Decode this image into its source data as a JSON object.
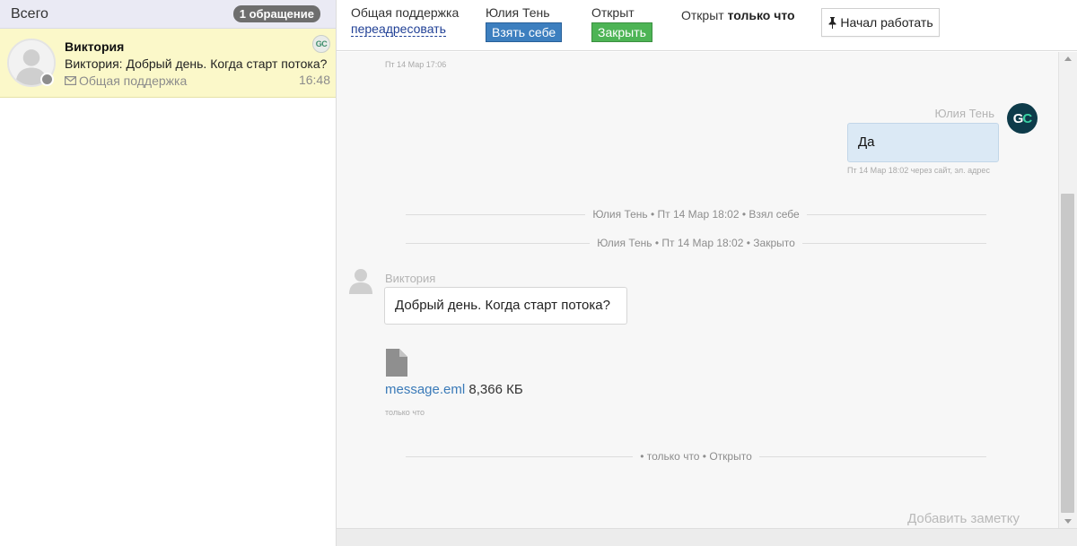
{
  "sidebar": {
    "title": "Всего",
    "count_badge": "1 обращение",
    "conversation": {
      "name": "Виктория",
      "preview": "Виктория: Добрый день. Когда старт потока?",
      "channel": "Общая поддержка",
      "time": "16:48",
      "agent_initials": "GC",
      "status_color": "#8e8e8e"
    }
  },
  "toolbar": {
    "department_label": "Общая поддержка",
    "redirect_link": "переадресовать",
    "agent_label": "Юлия Тень",
    "take_button": "Взять себе",
    "status_label": "Открыт",
    "close_button": "Закрыть",
    "opened_prefix": "Открыт",
    "opened_when": "только что",
    "start_button": "Начал работать"
  },
  "chat": {
    "top_timestamp": "Пт 14 Мар 17:06",
    "agent_message": {
      "sender": "Юлия Тень",
      "initials": "GC",
      "text": "Да",
      "meta": "Пт 14 Мар 18:02 через сайт, эл. адрес"
    },
    "system_events": [
      "Юлия Тень • Пт 14 Мар 18:02 • Взял себе",
      "Юлия Тень • Пт 14 Мар 18:02 • Закрыто"
    ],
    "customer_message": {
      "sender": "Виктория",
      "text": "Добрый день. Когда старт потока?"
    },
    "attachment": {
      "icon": "file-icon",
      "filename": "message.eml",
      "size": "8,366 КБ",
      "time": "только что"
    },
    "last_event": "• только что • Открыто",
    "add_note": "Добавить заметку"
  },
  "colors": {
    "accent_blue": "#3d7fbf",
    "accent_green": "#4db455",
    "highlight_yellow": "#fbf8c9",
    "bubble_blue": "#dbe9f5"
  }
}
